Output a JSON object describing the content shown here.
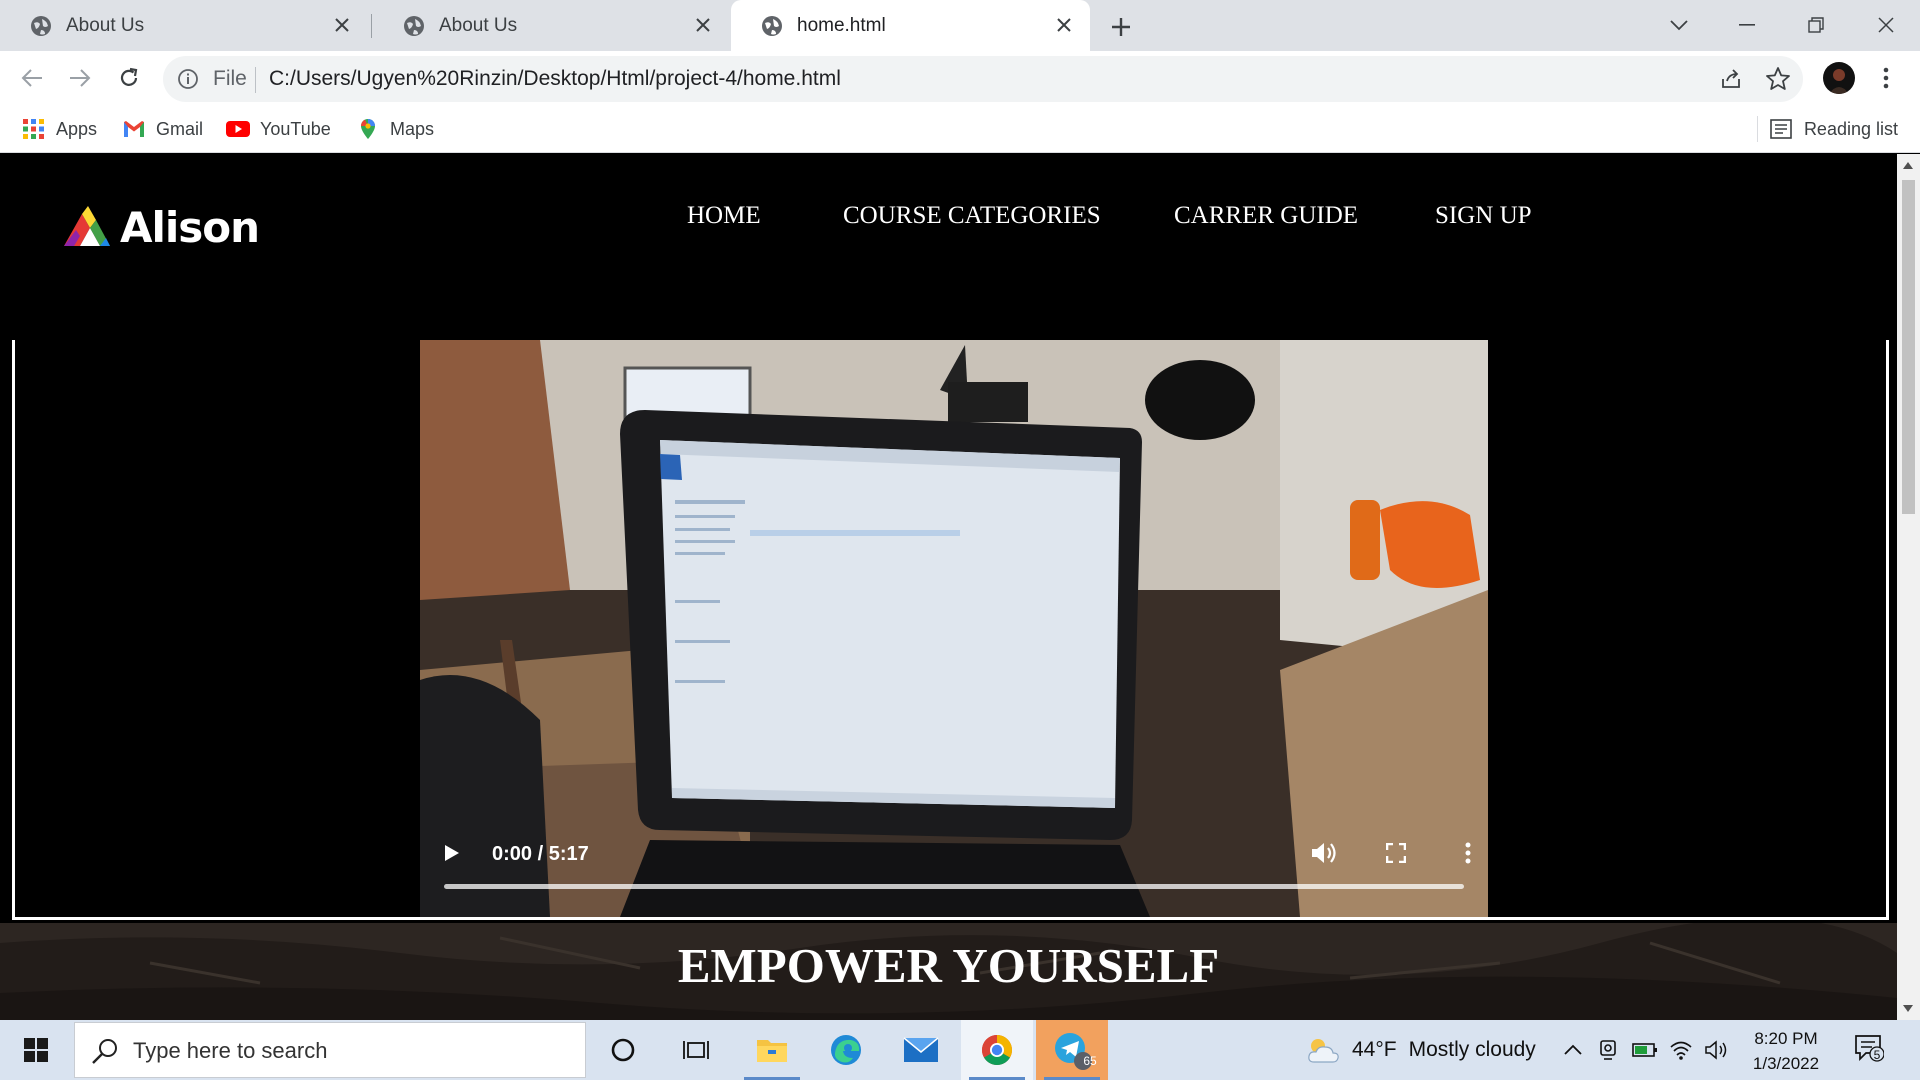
{
  "browser": {
    "tabs": [
      {
        "title": "About Us",
        "active": false
      },
      {
        "title": "About Us",
        "active": false
      },
      {
        "title": "home.html",
        "active": true
      }
    ],
    "address": {
      "scheme_label": "File",
      "url": "C:/Users/Ugyen%20Rinzin/Desktop/Html/project-4/home.html"
    },
    "bookmarks": [
      {
        "label": "Apps",
        "icon": "apps-grid-icon"
      },
      {
        "label": "Gmail",
        "icon": "gmail-icon"
      },
      {
        "label": "YouTube",
        "icon": "youtube-icon"
      },
      {
        "label": "Maps",
        "icon": "maps-icon"
      }
    ],
    "reading_list": "Reading list"
  },
  "site": {
    "logo_text": "Alison",
    "nav": [
      "HOME",
      "COURSE CATEGORIES",
      "CARRER GUIDE",
      "SIGN UP"
    ],
    "video": {
      "time": "0:00 / 5:17",
      "progress": 0
    },
    "hero_title": "EMPOWER YOURSELF"
  },
  "taskbar": {
    "search_placeholder": "Type here to search",
    "weather_temp": "44°F",
    "weather_text": "Mostly cloudy",
    "time": "8:20 PM",
    "date": "1/3/2022",
    "telegram_badge": "65",
    "notification_count": "5"
  },
  "colors": {
    "tab_strip": "#dee1e6",
    "page_bg": "#000000",
    "taskbar": "#d9e3f0"
  }
}
